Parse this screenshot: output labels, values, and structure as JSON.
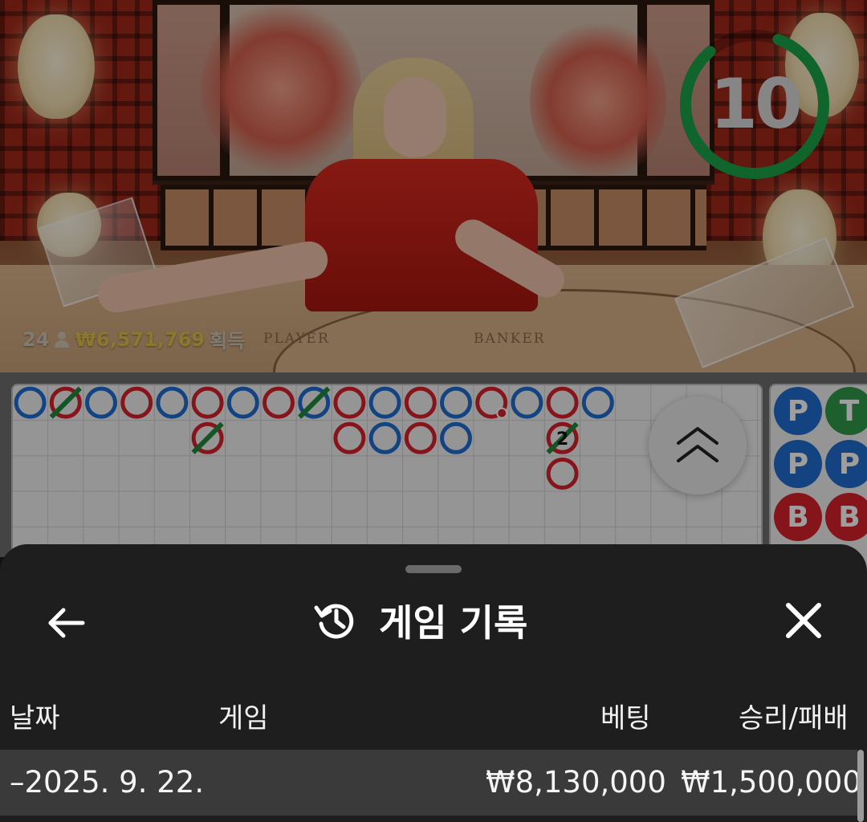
{
  "video": {
    "timer_value": "10",
    "timer_color": "#1aa34a",
    "winners_count": "24",
    "winners_amount": "₩6,571,769",
    "winners_suffix": "획득",
    "table_labels": {
      "player": "PLAYER",
      "banker": "BANKER"
    }
  },
  "big_road": {
    "colors": {
      "player": "#1f6fd1",
      "banker": "#d9212c",
      "tie": "#1f8a3a"
    },
    "columns": [
      [
        {
          "side": "player"
        }
      ],
      [
        {
          "side": "banker",
          "tie": true
        }
      ],
      [
        {
          "side": "player"
        }
      ],
      [
        {
          "side": "banker"
        }
      ],
      [
        {
          "side": "player"
        }
      ],
      [
        {
          "side": "banker"
        },
        {
          "side": "banker",
          "tie": true
        }
      ],
      [
        {
          "side": "player"
        }
      ],
      [
        {
          "side": "banker"
        }
      ],
      [
        {
          "side": "player",
          "tie": true
        }
      ],
      [
        {
          "side": "banker"
        },
        {
          "side": "banker"
        }
      ],
      [
        {
          "side": "player"
        },
        {
          "side": "player"
        }
      ],
      [
        {
          "side": "banker"
        },
        {
          "side": "banker"
        }
      ],
      [
        {
          "side": "player"
        },
        {
          "side": "player"
        }
      ],
      [
        {
          "side": "banker",
          "pair": true
        }
      ],
      [
        {
          "side": "player"
        }
      ],
      [
        {
          "side": "banker"
        },
        {
          "side": "banker",
          "tie": true,
          "tie_count": "2"
        },
        {
          "side": "banker"
        }
      ],
      [
        {
          "side": "player"
        }
      ]
    ]
  },
  "side_stats": {
    "chips": [
      {
        "label": "P",
        "color": "#1f6fd1"
      },
      {
        "label": "T",
        "color": "#2f9a4a"
      },
      {
        "label": "P",
        "color": "#1f6fd1"
      },
      {
        "label": "P",
        "color": "#1f6fd1"
      },
      {
        "label": "B",
        "color": "#d9212c"
      },
      {
        "label": "B",
        "color": "#d9212c"
      }
    ]
  },
  "sheet": {
    "title": "게임 기록",
    "columns": {
      "date": "날짜",
      "game": "게임",
      "bet": "베팅",
      "result": "승리/패배"
    },
    "rows": [
      {
        "date": "–2025. 9. 22.",
        "game": "",
        "bet": "₩8,130,000",
        "result": "₩1,500,000"
      }
    ]
  }
}
